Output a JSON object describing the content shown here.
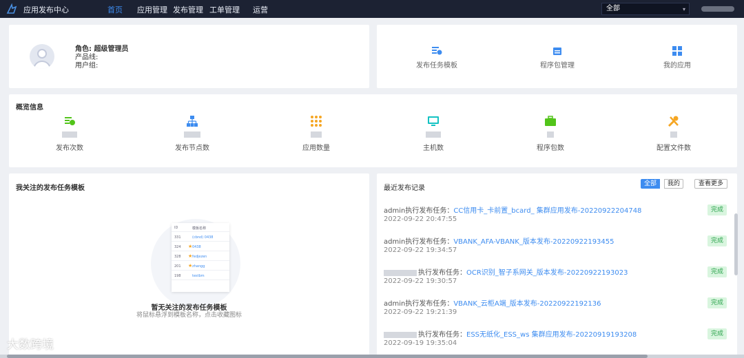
{
  "header": {
    "app_title": "应用发布中心",
    "nav": [
      "首页",
      "应用管理",
      "发布管理",
      "工单管理",
      "运营"
    ],
    "env_select": "全部"
  },
  "profile": {
    "role_line": "角色: 超级管理员",
    "product_line": "产品线:",
    "user_group": "用户组:"
  },
  "quick_links": [
    {
      "label": "发布任务模板",
      "icon": "template-icon"
    },
    {
      "label": "程序包管理",
      "icon": "package-icon"
    },
    {
      "label": "我的应用",
      "icon": "apps-grid-icon"
    }
  ],
  "overview": {
    "title": "概览信息",
    "stats": [
      {
        "label": "发布次数",
        "icon": "publish-count-icon",
        "color": "#52c41a"
      },
      {
        "label": "发布节点数",
        "icon": "node-tree-icon",
        "color": "#3d8cf0"
      },
      {
        "label": "应用数量",
        "icon": "dots-grid-icon",
        "color": "#f5a623"
      },
      {
        "label": "主机数",
        "icon": "monitor-icon",
        "color": "#13c2c2"
      },
      {
        "label": "程序包数",
        "icon": "briefcase-icon",
        "color": "#52c41a"
      },
      {
        "label": "配置文件数",
        "icon": "tools-icon",
        "color": "#f5a623"
      }
    ]
  },
  "favorites": {
    "title": "我关注的发布任务模板",
    "empty_title": "暂无关注的发布任务模板",
    "empty_sub": "将鼠标悬浮到模板名称，点击收藏图标"
  },
  "records": {
    "title": "最近发布记录",
    "filter_all": "全部",
    "filter_mine": "我的",
    "more": "查看更多",
    "items": [
      {
        "prefix": "admin执行发布任务：",
        "task": "CC信用卡_卡前置_bcard_      集群应用发布-20220922204748",
        "time": "2022-09-22 20:47:55",
        "status": "完成"
      },
      {
        "prefix": "admin执行发布任务：",
        "task": "VBANK_AFA-VBANK_版本发布-20220922193455",
        "time": "2022-09-22 19:34:57",
        "status": "完成"
      },
      {
        "prefix": "执行发布任务：",
        "task": "OCR识别_智子系网关_版本发布-20220922193023",
        "time": "2022-09-22 19:30:57",
        "status": "完成"
      },
      {
        "prefix": "admin执行发布任务：",
        "task": "VBANK_云柜A端_版本发布-20220922192136",
        "time": "2022-09-22 19:21:39",
        "status": "完成"
      },
      {
        "prefix": "执行发布任务：",
        "task": "ESS无纸化_ESS_ws      集群应用发布-20220919193208",
        "time": "2022-09-19 19:35:04",
        "status": "完成"
      }
    ]
  },
  "watermark": "大数跨境"
}
